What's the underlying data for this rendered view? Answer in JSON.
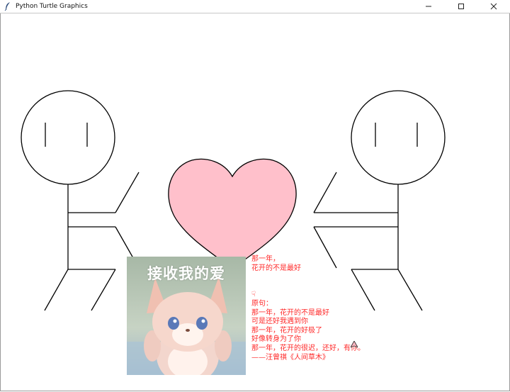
{
  "window": {
    "title": "Python Turtle Graphics",
    "icon": "feather-icon",
    "controls": [
      "minimize-icon",
      "maximize-icon",
      "close-icon"
    ]
  },
  "colors": {
    "heart_fill": "#ffc0cb",
    "text": "#ff2a2a",
    "line": "#000000"
  },
  "photo": {
    "caption": "接收我的爱"
  },
  "poem_lines": [
    "那一年，",
    "花开的不是最好",
    "",
    "",
    "☟",
    "原句：",
    "那一年，花开的不是最好",
    "可是还好我遇到你",
    "那一年，花开的好极了",
    "好像转身为了你",
    "那一年，花开的很迟，还好，有你。",
    "——汪曾祺《人间草木》"
  ]
}
